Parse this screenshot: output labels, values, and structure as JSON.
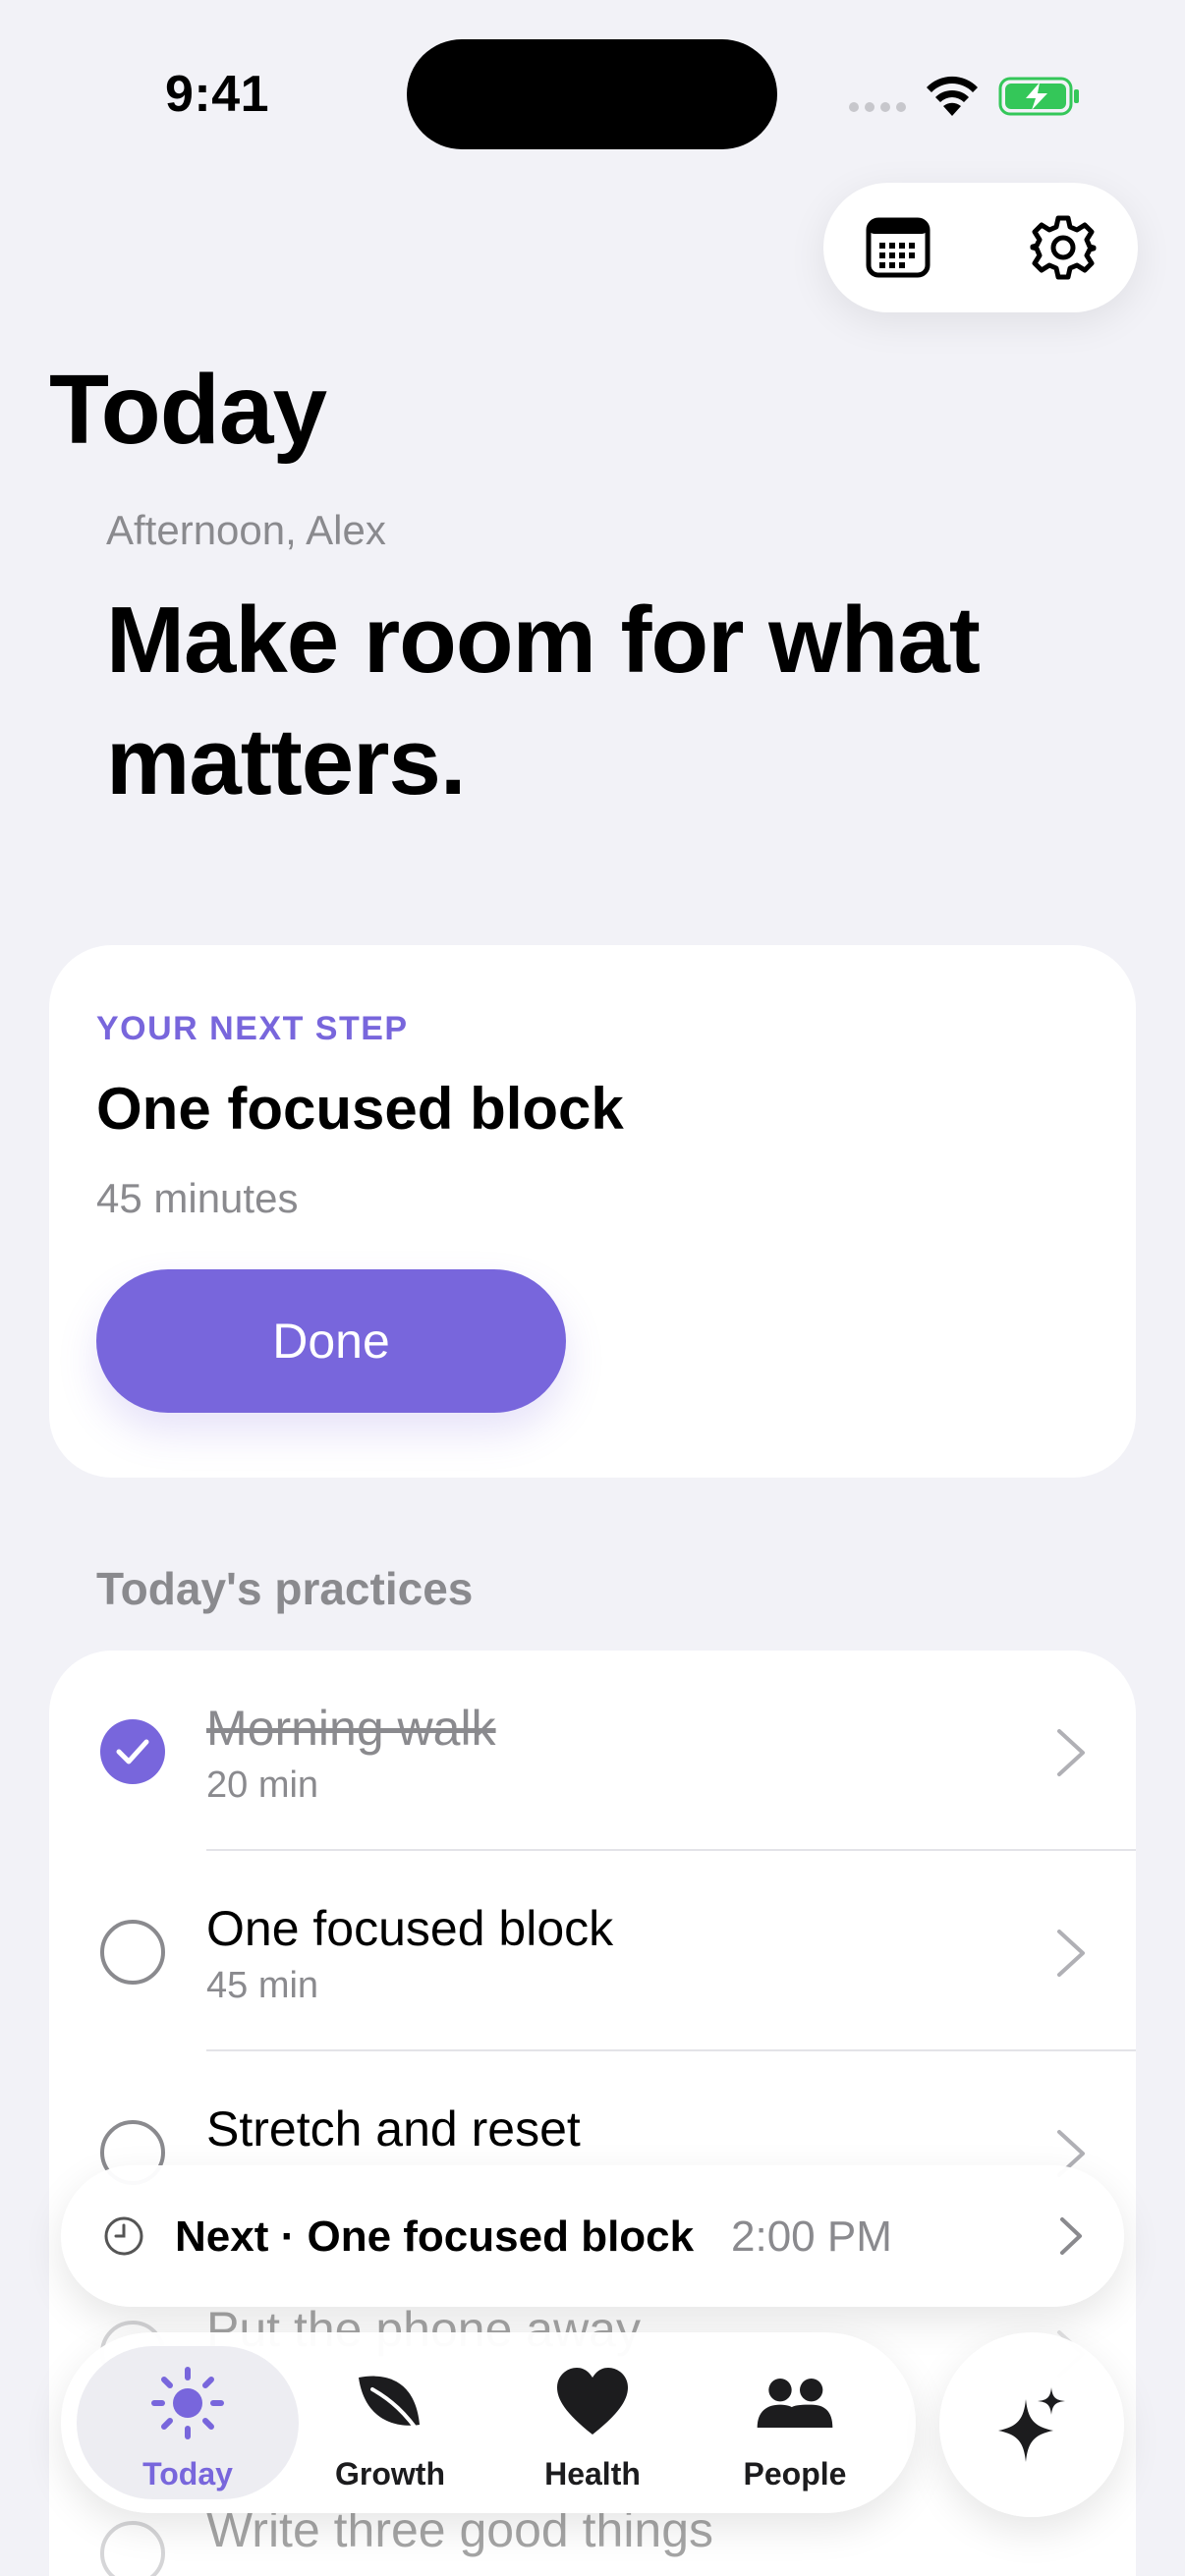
{
  "status_bar": {
    "time": "9:41"
  },
  "header": {
    "title": "Today"
  },
  "hero": {
    "greeting": "Afternoon, Alex",
    "headline": "Make room for what matters."
  },
  "next_step": {
    "eyebrow": "YOUR NEXT STEP",
    "title": "One focused block",
    "duration": "45 minutes",
    "done_label": "Done"
  },
  "practices": {
    "section_label": "Today's practices",
    "items": [
      {
        "name": "Morning walk",
        "meta": "20 min",
        "completed": true
      },
      {
        "name": "One focused block",
        "meta": "45 min",
        "completed": false
      },
      {
        "name": "Stretch and reset",
        "meta": "",
        "completed": false
      },
      {
        "name": "Put the phone away",
        "meta": "",
        "completed": false
      },
      {
        "name": "Write three good things",
        "meta": "",
        "completed": false
      }
    ]
  },
  "banner": {
    "title": "Next · One focused block",
    "time": "2:00 PM"
  },
  "tab_bar": {
    "tabs": [
      {
        "label": "Today",
        "icon": "sun-icon",
        "active": true
      },
      {
        "label": "Growth",
        "icon": "leaf-icon",
        "active": false
      },
      {
        "label": "Health",
        "icon": "heart-icon",
        "active": false
      },
      {
        "label": "People",
        "icon": "people-icon",
        "active": false
      }
    ]
  },
  "colors": {
    "accent": "#7866DC",
    "background": "#F2F2F7",
    "secondary_text": "#8A8A8E"
  }
}
